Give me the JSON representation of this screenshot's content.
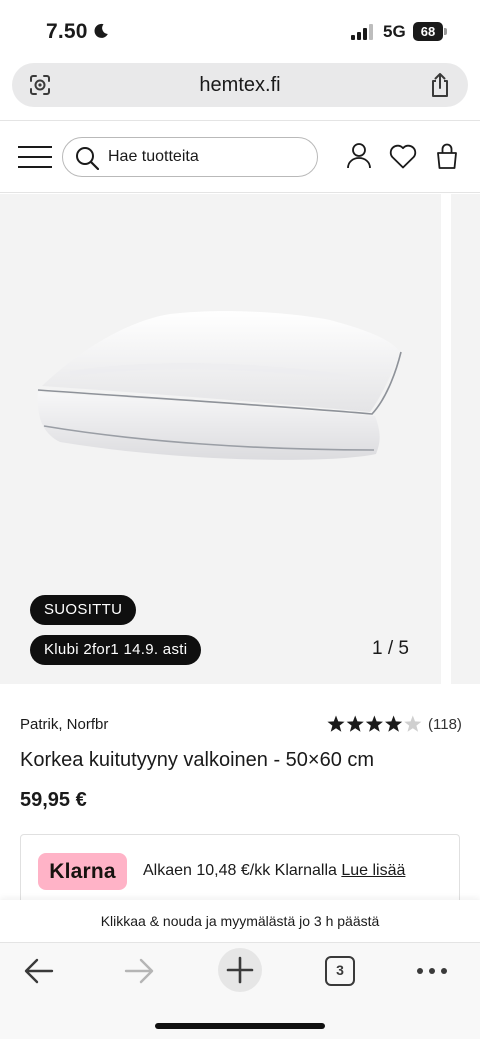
{
  "status_bar": {
    "time": "7.50",
    "network": "5G",
    "battery": "68"
  },
  "browser": {
    "url": "hemtex.fi",
    "tab_count": "3"
  },
  "header": {
    "search_placeholder": "Hae tuotteita"
  },
  "gallery": {
    "badges": [
      "SUOSITTU",
      "Klubi 2for1 14.9. asti"
    ],
    "pager": "1 / 5"
  },
  "product": {
    "brand": "Patrik, Norfbr",
    "rating": 4,
    "rating_max": 5,
    "review_count": "(118)",
    "title": "Korkea kuitutyyny valkoinen - 50×60 cm",
    "price": "59,95 €"
  },
  "klarna": {
    "logo": "Klarna",
    "text": "Alkaen 10,48 €/kk Klarnalla",
    "link": "Lue lisää",
    "logo_color": "#ffb3c7"
  },
  "pickup_notice": "Klikkaa & nouda ja myymälästä jo 3 h päästä",
  "icons": {
    "status": [
      "moon-icon",
      "signal-icon",
      "battery-icon"
    ],
    "address_bar": [
      "lens-icon",
      "share-icon"
    ],
    "header": [
      "hamburger-menu-icon",
      "search-icon",
      "user-icon",
      "heart-icon",
      "bag-icon"
    ],
    "toolbar": [
      "back-arrow-icon",
      "forward-arrow-icon",
      "plus-icon",
      "tabs-icon",
      "more-icon"
    ]
  }
}
